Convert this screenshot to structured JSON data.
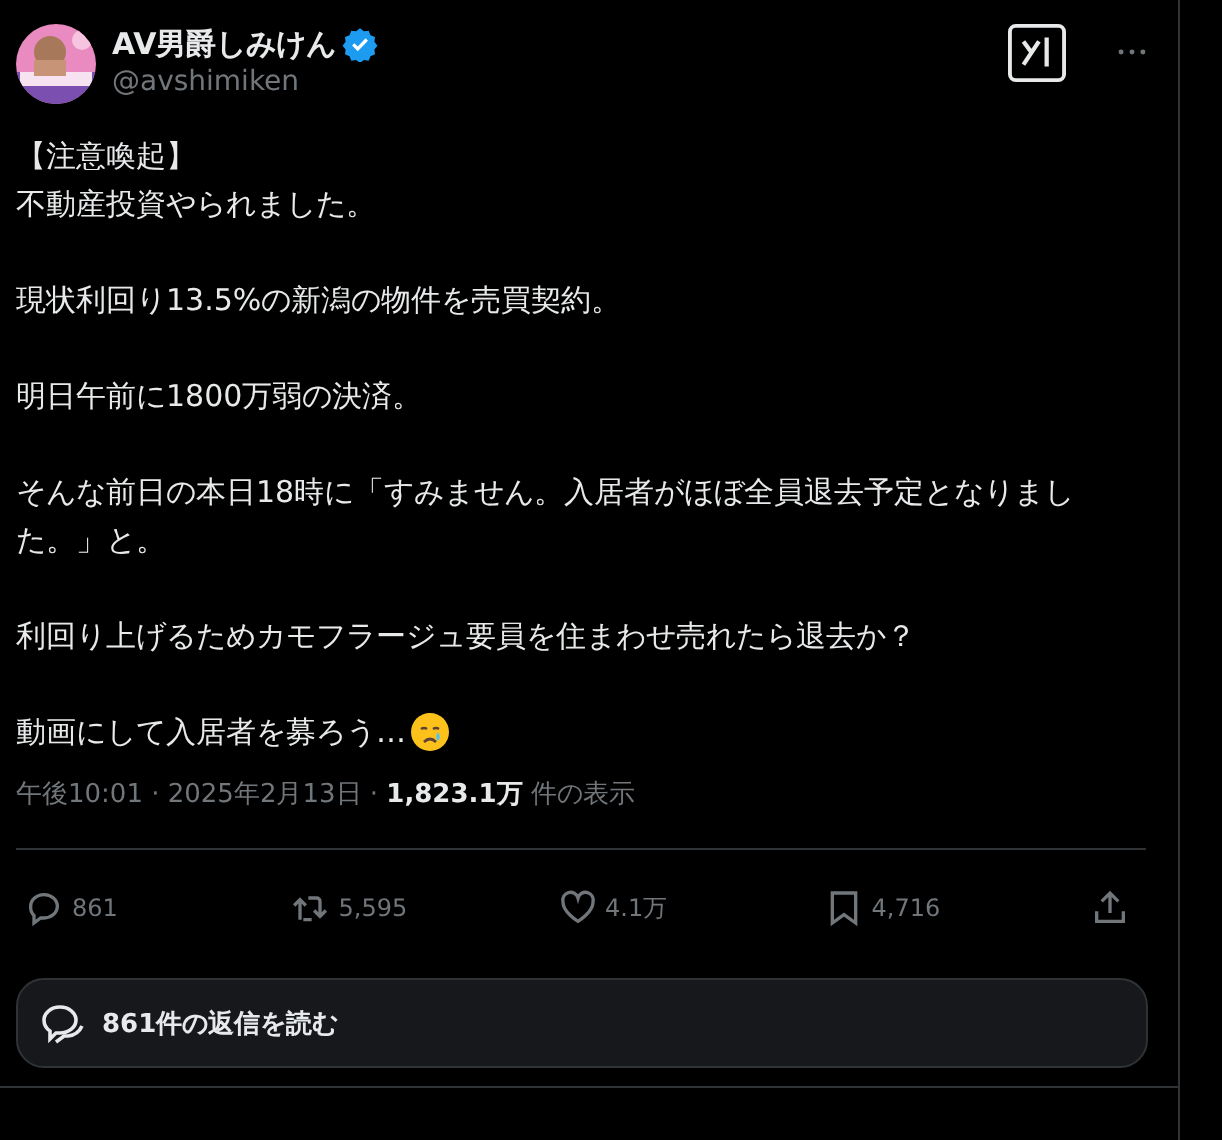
{
  "author": {
    "name": "AV男爵しみけん",
    "verified": true,
    "handle": "@avshimiken"
  },
  "post": {
    "paragraphs": [
      [
        "【注意喚起】",
        "不動産投資やられました。"
      ],
      [
        "現状利回り13.5%の新潟の物件を売買契約。"
      ],
      [
        "明日午前に1800万弱の決済。"
      ],
      [
        "そんな前日の本日18時に「すみません。入居者がほぼ全員退去予定となりました。」と。"
      ],
      [
        "利回り上げるためカモフラージュ要員を住まわせ売れたら退去か？"
      ],
      [
        "動画にして入居者を募ろう…"
      ]
    ],
    "meta": "午後10:01 · 2025年2月13日 · **1,823.1万** 件の表示"
  },
  "actions": [
    {
      "kind": "reply",
      "count": "861"
    },
    {
      "kind": "repost",
      "count": "5,595"
    },
    {
      "kind": "like",
      "count": "4.1万"
    },
    {
      "kind": "bookmark",
      "count": "4,716"
    },
    {
      "kind": "share"
    }
  ],
  "read_replies": "861件の返信を読む"
}
